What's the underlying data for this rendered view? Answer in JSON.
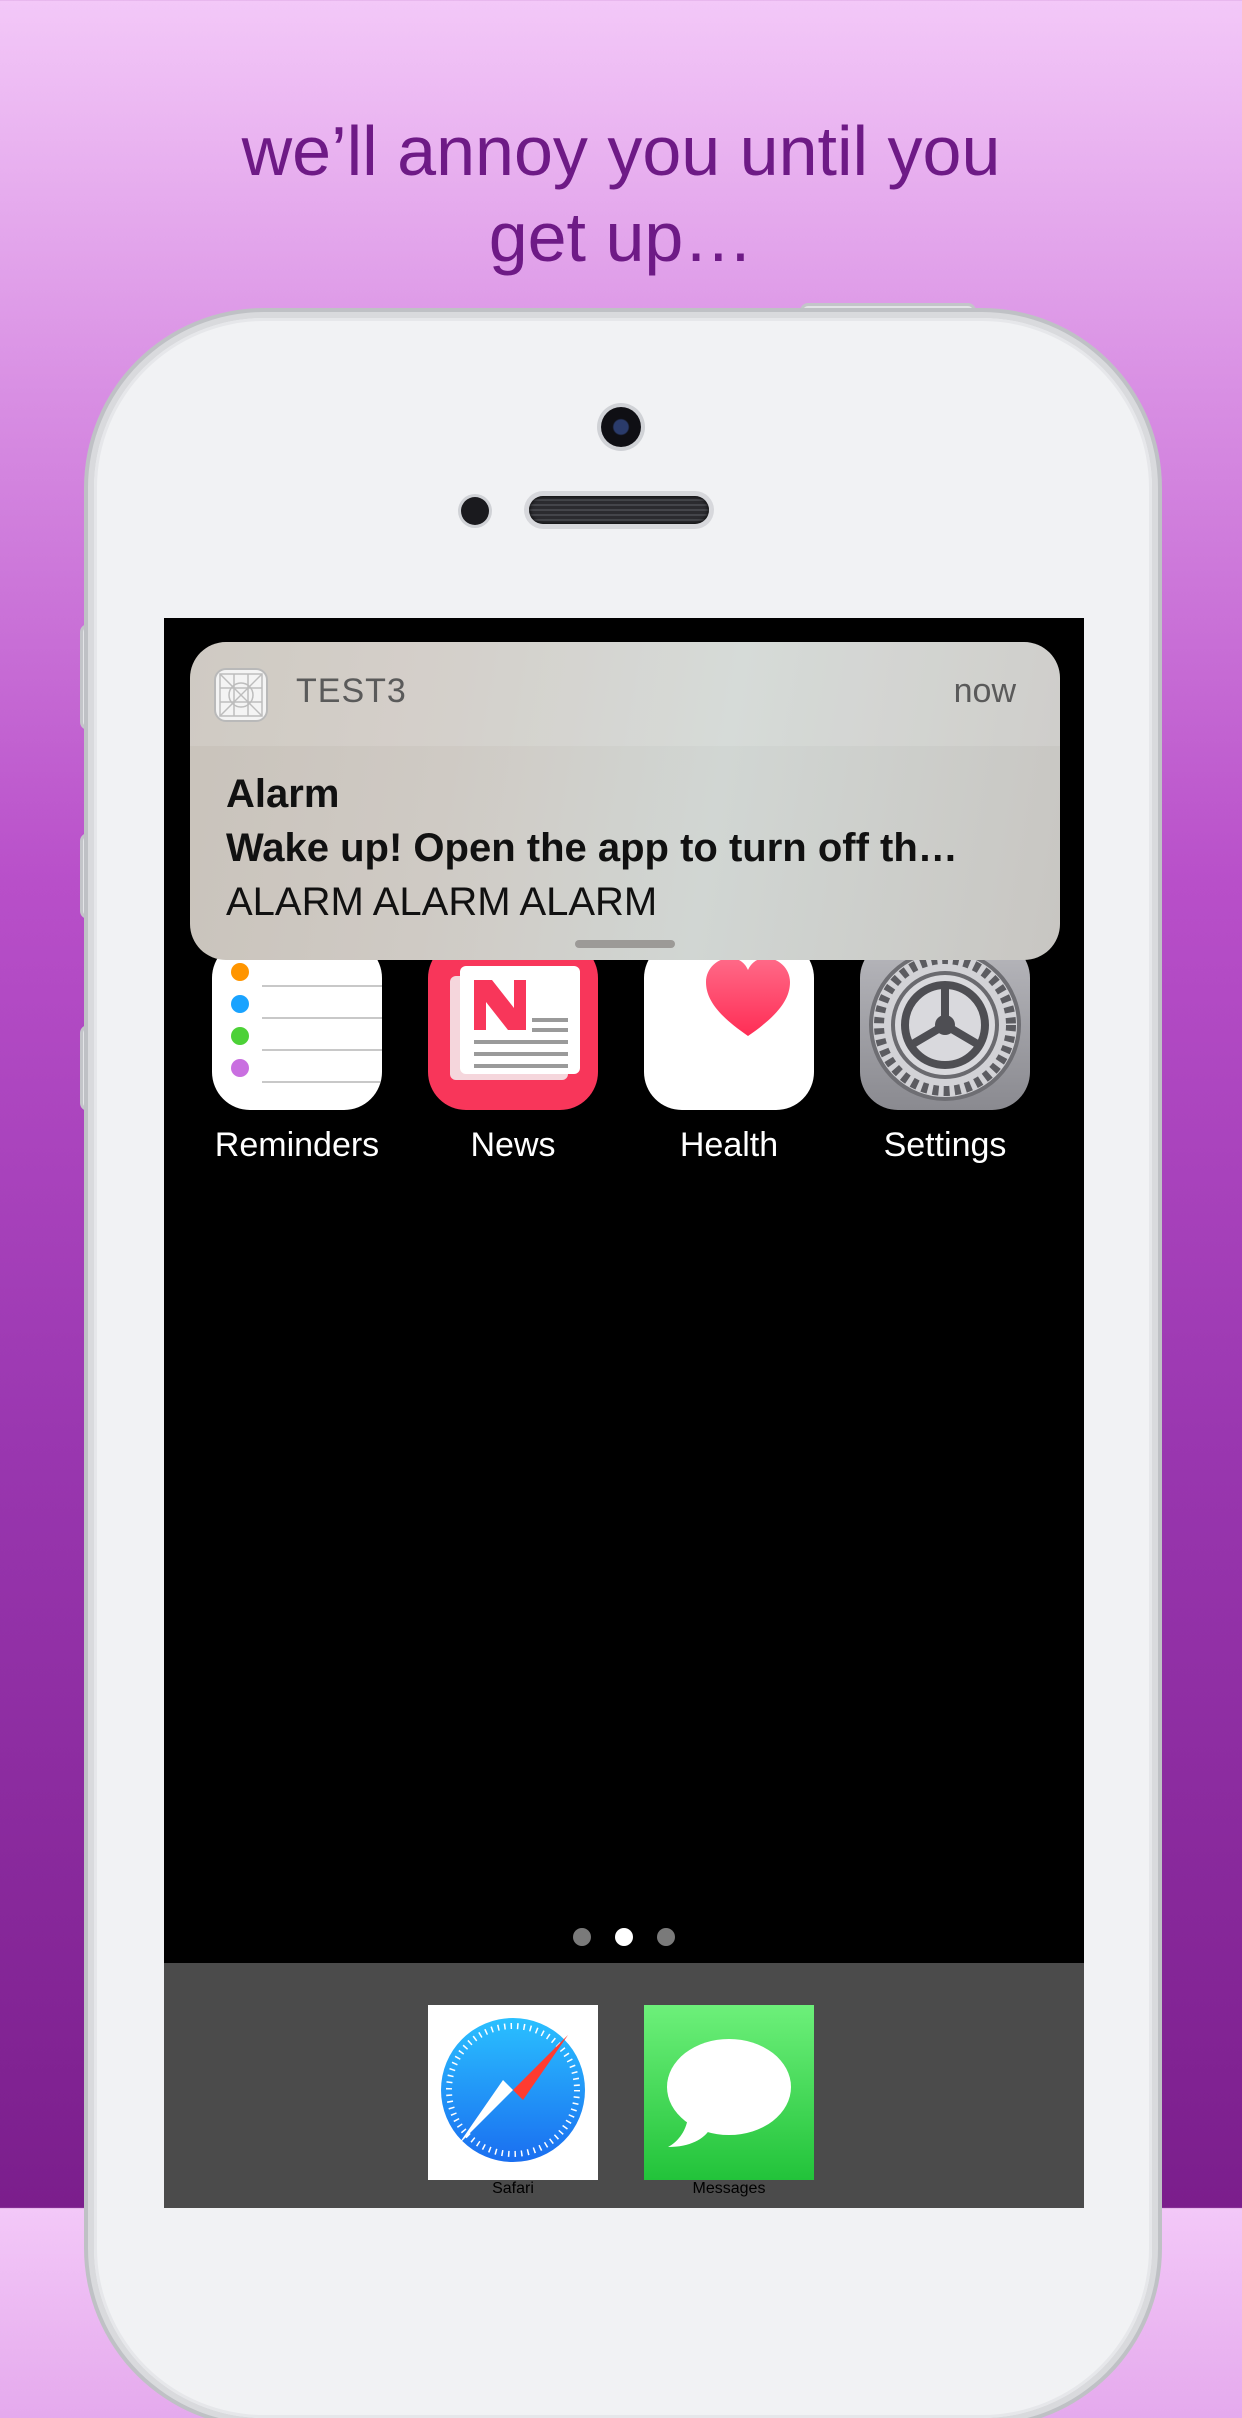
{
  "headline": {
    "line1": "we’ll annoy you until you",
    "line2": "get up…"
  },
  "notification": {
    "app_name": "TEST3",
    "time": "now",
    "title": "Alarm",
    "subtitle": "Wake up! Open the app to turn off th…",
    "body": "ALARM ALARM ALARM"
  },
  "apps": [
    {
      "label": "Reminders",
      "icon": "reminders-icon"
    },
    {
      "label": "News",
      "icon": "news-icon"
    },
    {
      "label": "Health",
      "icon": "health-icon"
    },
    {
      "label": "Settings",
      "icon": "settings-icon"
    }
  ],
  "page_dots": {
    "count": 3,
    "active": 2
  },
  "dock": [
    {
      "label": "Safari",
      "icon": "safari-icon"
    },
    {
      "label": "Messages",
      "icon": "messages-icon"
    }
  ],
  "colors": {
    "headline": "#6e1a86",
    "news": "#f8365a",
    "health_heart": "#ff3b5c",
    "messages": "#34c84a",
    "safari": "#1e88f5"
  }
}
